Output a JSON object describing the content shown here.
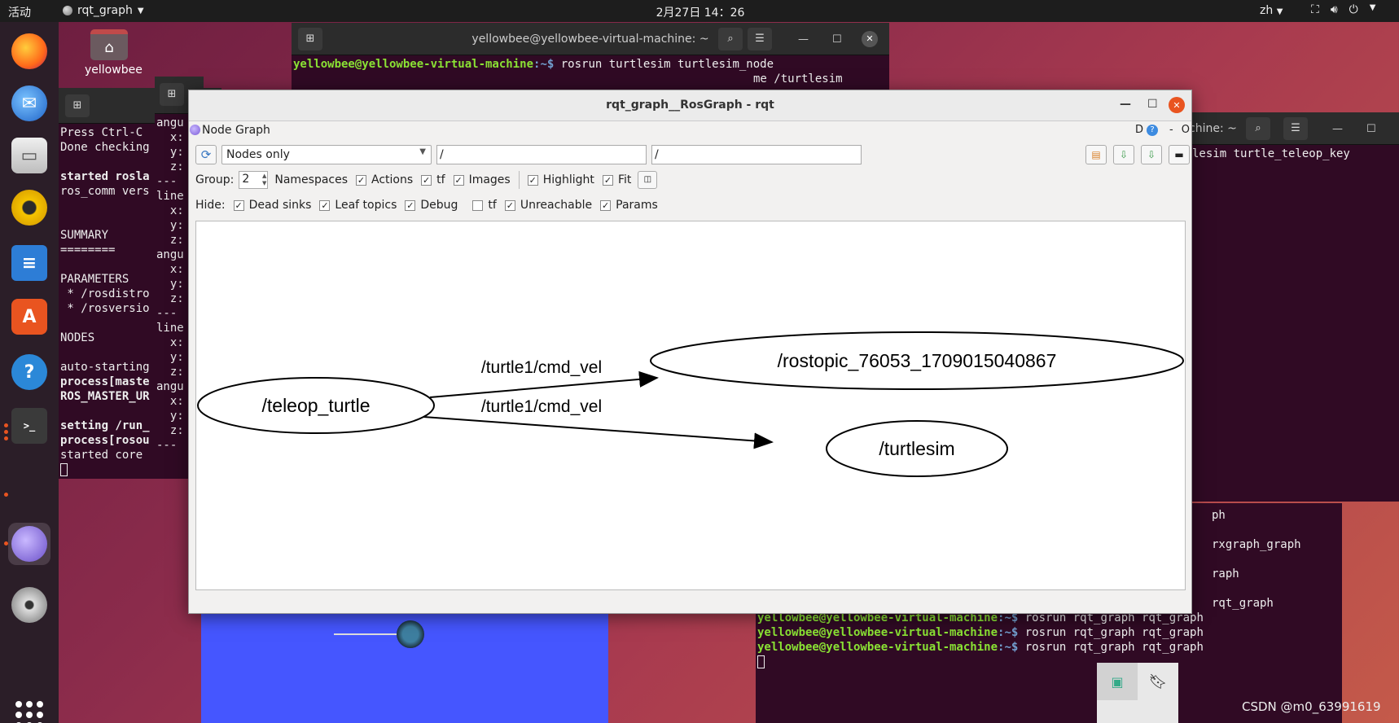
{
  "topbar": {
    "activities": "活动",
    "app_name": "rqt_graph",
    "clock": "2月27日  14：26",
    "lang": "zh"
  },
  "desktop": {
    "folder_label": "yellowbee"
  },
  "terminal_top": {
    "title": "yellowbee@yellowbee-virtual-machine: ~",
    "prompt_user": "yellowbee@yellowbee-virtual-machine",
    "prompt_path": ":~$ ",
    "command": "rosrun turtlesim turtlesim_node",
    "line2": "me /turtlesim"
  },
  "terminal_left": {
    "lines": [
      "Press Ctrl-C",
      "Done checking",
      "",
      "started rosla",
      "ros_comm vers",
      "",
      "",
      "SUMMARY",
      "========",
      "",
      "PARAMETERS",
      " * /rosdistro",
      " * /rosversio",
      "",
      "NODES",
      "",
      "auto-starting",
      "process[maste",
      "ROS_MASTER_UR",
      "",
      "setting /run_",
      "process[rosou",
      "started core "
    ]
  },
  "terminal_mid": {
    "lines": [
      "angu",
      "  x:",
      "  y:",
      "  z:",
      "---",
      "line",
      "  x:",
      "  y:",
      "  z:",
      "angu",
      "  x:",
      "  y:",
      "  z:",
      "---",
      "line",
      "  x:",
      "  y:",
      "  z:",
      "angu",
      "  x:",
      "  y:",
      "  z:",
      "---"
    ]
  },
  "terminal_right": {
    "title_fragment": "chine: ~",
    "line1": "lesim turtle_teleop_key"
  },
  "terminal_bottom": {
    "lines_partial": [
      "ph",
      "",
      "rxgraph_graph",
      "",
      "raph",
      "",
      "rqt_graph"
    ],
    "prompt_user": "yellowbee@yellowbee-virtual-machine",
    "prompt_path": ":~$ ",
    "command": "rosrun rqt_graph rqt_graph"
  },
  "rqt": {
    "title": "rqt_graph__RosGraph - rqt",
    "plugin_name": "Node Graph",
    "plugin_right": {
      "d_label": "D",
      "help": "?",
      "dash": "-",
      "o_label": "O"
    },
    "filter_mode": "Nodes only",
    "ns_filter": "/",
    "topic_filter": "/",
    "group_label": "Group:",
    "group_value": "2",
    "namespaces_label": "Namespaces",
    "actions_label": "Actions",
    "tf_label": "tf",
    "images_label": "Images",
    "highlight_label": "Highlight",
    "fit_label": "Fit",
    "hide_label": "Hide:",
    "dead_sinks_label": "Dead sinks",
    "leaf_topics_label": "Leaf topics",
    "debug_label": "Debug",
    "hide_tf_label": "tf",
    "unreachable_label": "Unreachable",
    "params_label": "Params",
    "check": "✓"
  },
  "graph": {
    "nodes": [
      {
        "id": "teleop",
        "label": "/teleop_turtle"
      },
      {
        "id": "rostopic",
        "label": "/rostopic_76053_1709015040867"
      },
      {
        "id": "turtlesim",
        "label": "/turtlesim"
      }
    ],
    "edges": [
      {
        "from": "teleop",
        "to": "rostopic",
        "label": "/turtle1/cmd_vel"
      },
      {
        "from": "teleop",
        "to": "turtlesim",
        "label": "/turtle1/cmd_vel"
      }
    ]
  },
  "watermark": "CSDN @m0_63991619",
  "colors": {
    "accent": "#e95420",
    "terminal_bg": "#300a24",
    "prompt_green": "#8ae234",
    "prompt_blue": "#729fcf",
    "turtlesim_bg": "#4556ff"
  }
}
